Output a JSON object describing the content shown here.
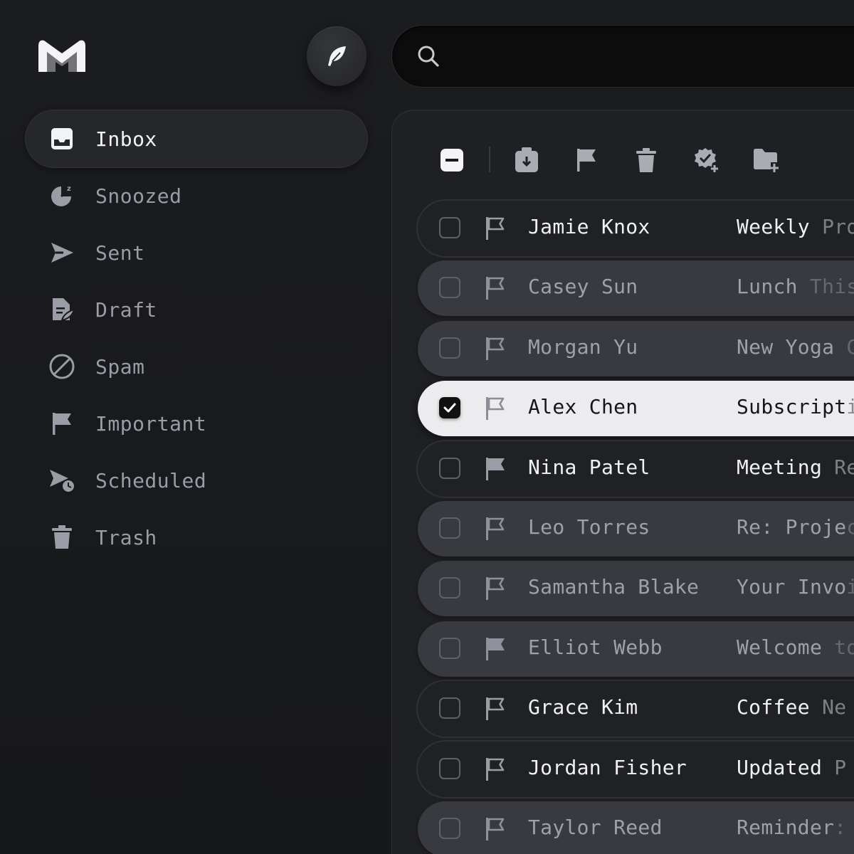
{
  "app": {
    "name": "Mail"
  },
  "colors": {
    "accent": "#f2f3f5",
    "muted": "#9a9da5",
    "background": "#18191c"
  },
  "search": {
    "placeholder": "",
    "value": ""
  },
  "compose": {
    "icon": "feather-icon"
  },
  "nav": [
    {
      "id": "inbox",
      "label": "Inbox",
      "icon": "inbox-icon",
      "active": true
    },
    {
      "id": "snoozed",
      "label": "Snoozed",
      "icon": "snooze-clock-icon",
      "active": false
    },
    {
      "id": "sent",
      "label": "Sent",
      "icon": "send-icon",
      "active": false
    },
    {
      "id": "draft",
      "label": "Draft",
      "icon": "draft-icon",
      "active": false
    },
    {
      "id": "spam",
      "label": "Spam",
      "icon": "block-icon",
      "active": false
    },
    {
      "id": "important",
      "label": "Important",
      "icon": "flag-icon",
      "active": false
    },
    {
      "id": "scheduled",
      "label": "Scheduled",
      "icon": "scheduled-send-icon",
      "active": false
    },
    {
      "id": "trash",
      "label": "Trash",
      "icon": "trash-icon",
      "active": false
    }
  ],
  "toolbar": {
    "actions": [
      "select-partial-icon",
      "archive-icon",
      "flag-icon",
      "trash-icon",
      "mark-done-icon",
      "move-to-folder-icon"
    ]
  },
  "emails": [
    {
      "sender": "Jamie Knox",
      "subject_visible": "Weekly",
      "subject_clipped": " Pro",
      "style": "dark",
      "checked": false,
      "flagged": false
    },
    {
      "sender": "Casey Sun",
      "subject_visible": "Lunch",
      "subject_clipped": " This",
      "style": "mid",
      "checked": false,
      "flagged": false
    },
    {
      "sender": "Morgan Yu",
      "subject_visible": "New Yoga",
      "subject_clipped": " C",
      "style": "mid",
      "checked": false,
      "flagged": false
    },
    {
      "sender": "Alex Chen",
      "subject_visible": "Subscript",
      "subject_clipped": "i",
      "style": "light",
      "checked": true,
      "flagged": false
    },
    {
      "sender": "Nina Patel",
      "subject_visible": "Meeting",
      "subject_clipped": " Re",
      "style": "dark",
      "checked": false,
      "flagged": true
    },
    {
      "sender": "Leo Torres",
      "subject_visible": "Re: Proje",
      "subject_clipped": "c",
      "style": "mid",
      "checked": false,
      "flagged": false
    },
    {
      "sender": "Samantha Blake",
      "subject_visible": "Your Invo",
      "subject_clipped": "i",
      "style": "mid",
      "checked": false,
      "flagged": false
    },
    {
      "sender": "Elliot Webb",
      "subject_visible": "Welcome",
      "subject_clipped": " to",
      "style": "mid",
      "checked": false,
      "flagged": true
    },
    {
      "sender": "Grace Kim",
      "subject_visible": "Coffee",
      "subject_clipped": " Ne",
      "style": "dark",
      "checked": false,
      "flagged": false
    },
    {
      "sender": "Jordan Fisher",
      "subject_visible": "Updated",
      "subject_clipped": " P",
      "style": "dark",
      "checked": false,
      "flagged": false
    },
    {
      "sender": "Taylor Reed",
      "subject_visible": "Reminder",
      "subject_clipped": ":",
      "style": "mid",
      "checked": false,
      "flagged": false
    }
  ]
}
